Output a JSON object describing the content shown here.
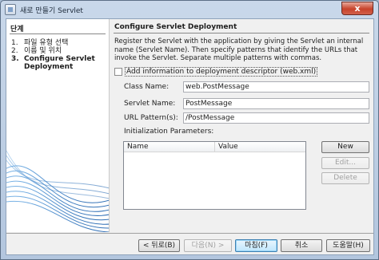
{
  "window": {
    "title": "새로 만들기 Servlet",
    "close_glyph": "x"
  },
  "steps": {
    "title": "단계",
    "items": [
      {
        "num": "1.",
        "label": "파일 유형 선택",
        "active": false
      },
      {
        "num": "2.",
        "label": "이름 및 위치",
        "active": false
      },
      {
        "num": "3.",
        "label": "Configure Servlet",
        "active": true
      },
      {
        "num": "",
        "label": "Deployment",
        "active": true
      }
    ]
  },
  "panel": {
    "title": "Configure Servlet Deployment",
    "description": "Register the Servlet with the application by giving the Servlet an internal name (Servlet Name). Then specify patterns that identify the URLs that invoke the Servlet. Separate multiple patterns with commas.",
    "checkbox_label": "Add information to deployment descriptor (web.xml)",
    "checkbox_checked": false,
    "fields": {
      "class_name_label": "Class Name:",
      "class_name_value": "web.PostMessage",
      "servlet_name_label": "Servlet Name:",
      "servlet_name_value": "PostMessage",
      "url_pattern_label": "URL Pattern(s):",
      "url_pattern_value": "/PostMessage"
    },
    "init_params": {
      "label": "Initialization Parameters:",
      "columns": [
        "Name",
        "Value"
      ],
      "rows": []
    },
    "side_buttons": {
      "new": "New",
      "edit": "Edit...",
      "delete": "Delete"
    }
  },
  "buttons": {
    "back": "< 뒤로(B)",
    "next": "다음(N) >",
    "finish": "마침(F)",
    "cancel": "취소",
    "help": "도움말(H)"
  }
}
